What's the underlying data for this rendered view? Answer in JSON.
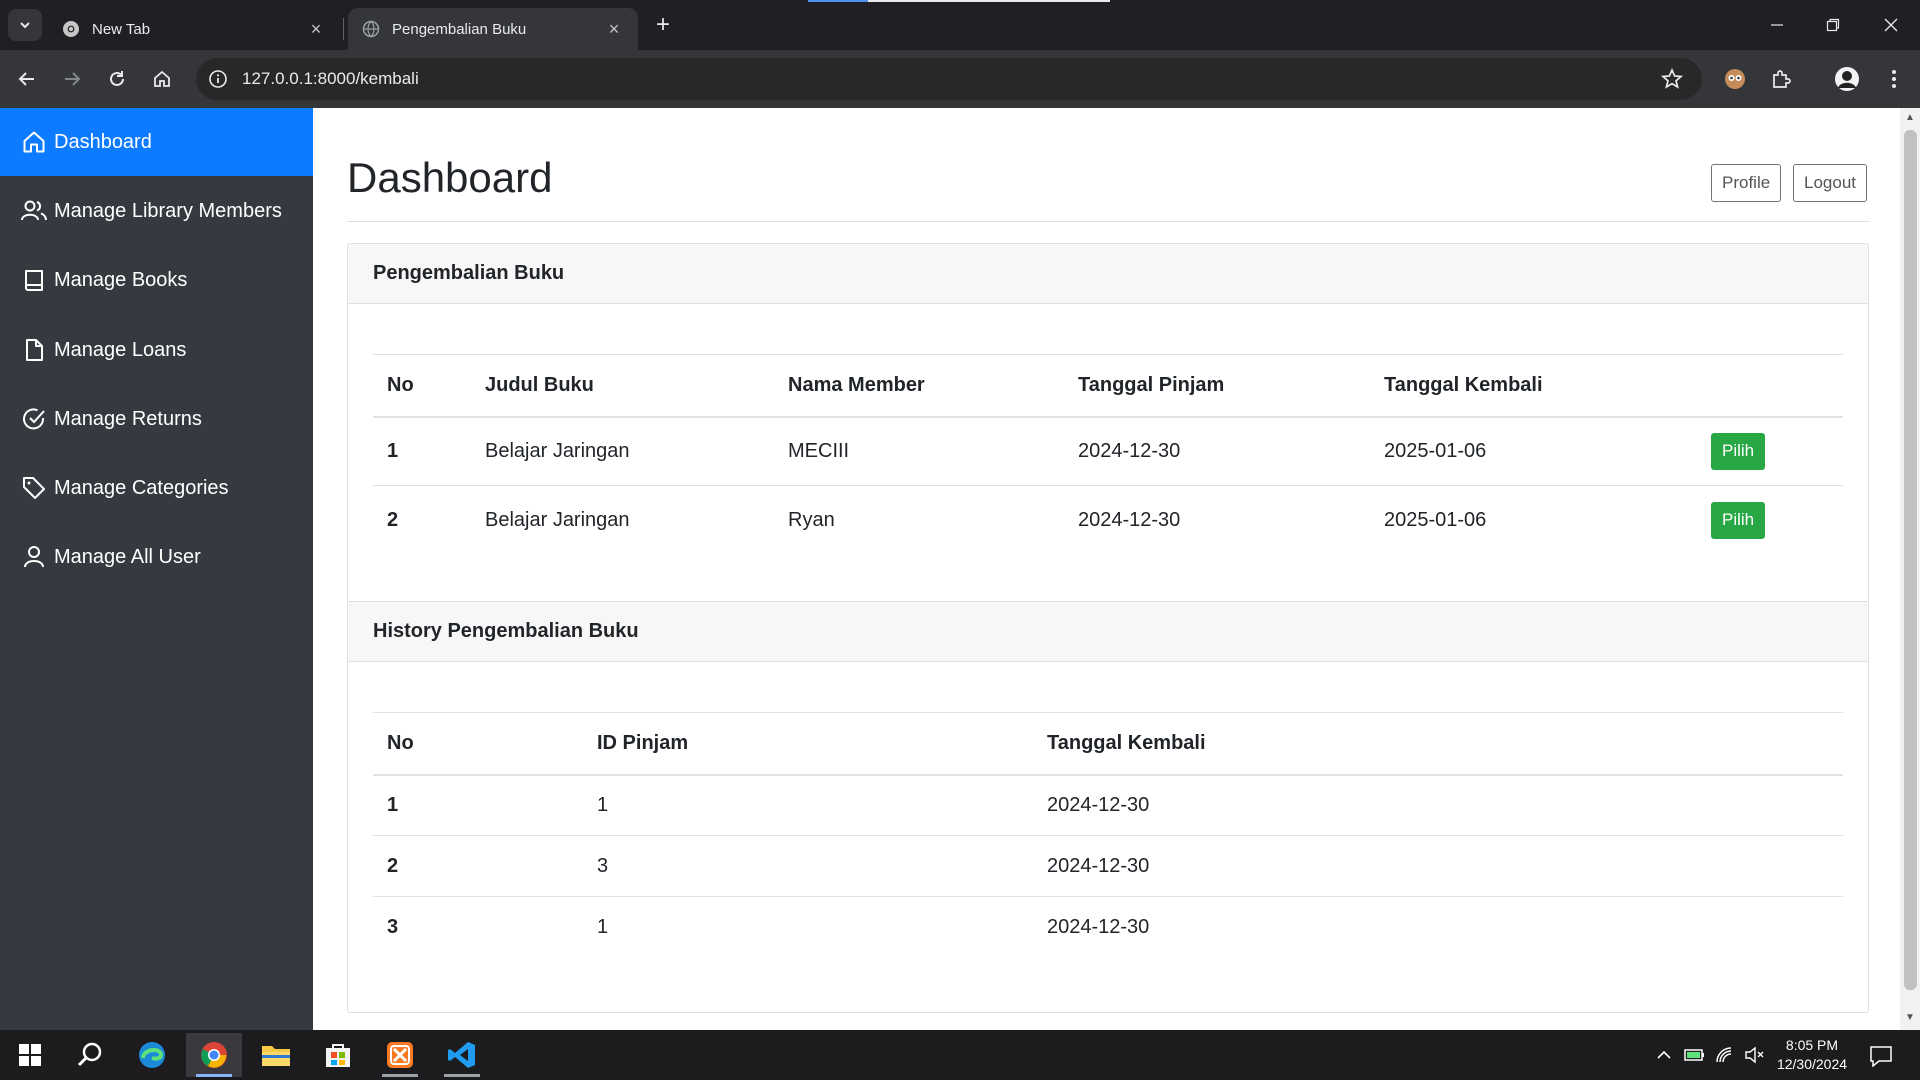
{
  "browser": {
    "tabs": [
      {
        "title": "New Tab",
        "active": false
      },
      {
        "title": "Pengembalian Buku",
        "active": true
      }
    ],
    "url": "127.0.0.1:8000/kembali"
  },
  "sidebar": {
    "items": [
      {
        "label": "Dashboard",
        "icon": "home-icon",
        "active": true
      },
      {
        "label": "Manage Library Members",
        "icon": "users-icon"
      },
      {
        "label": "Manage Books",
        "icon": "book-icon"
      },
      {
        "label": "Manage Loans",
        "icon": "file-icon"
      },
      {
        "label": "Manage Returns",
        "icon": "check-circle-icon"
      },
      {
        "label": "Manage Categories",
        "icon": "tag-icon"
      },
      {
        "label": "Manage All User",
        "icon": "user-icon"
      }
    ]
  },
  "header": {
    "title": "Dashboard",
    "profile_label": "Profile",
    "logout_label": "Logout"
  },
  "returns": {
    "title": "Pengembalian Buku",
    "columns": [
      "No",
      "Judul Buku",
      "Nama Member",
      "Tanggal Pinjam",
      "Tanggal Kembali"
    ],
    "action_label": "Pilih",
    "rows": [
      {
        "no": "1",
        "judul": "Belajar Jaringan",
        "member": "MECIII",
        "pinjam": "2024-12-30",
        "kembali": "2025-01-06"
      },
      {
        "no": "2",
        "judul": "Belajar Jaringan",
        "member": "Ryan",
        "pinjam": "2024-12-30",
        "kembali": "2025-01-06"
      }
    ]
  },
  "history": {
    "title": "History Pengembalian Buku",
    "columns": [
      "No",
      "ID Pinjam",
      "Tanggal Kembali"
    ],
    "rows": [
      {
        "no": "1",
        "id_pinjam": "1",
        "kembali": "2024-12-30"
      },
      {
        "no": "2",
        "id_pinjam": "3",
        "kembali": "2024-12-30"
      },
      {
        "no": "3",
        "id_pinjam": "1",
        "kembali": "2024-12-30"
      }
    ]
  },
  "taskbar": {
    "time": "8:05 PM",
    "date": "12/30/2024"
  },
  "colors": {
    "sidebar_bg": "#343a40",
    "active_nav": "#0d7bff",
    "success": "#28a745"
  }
}
